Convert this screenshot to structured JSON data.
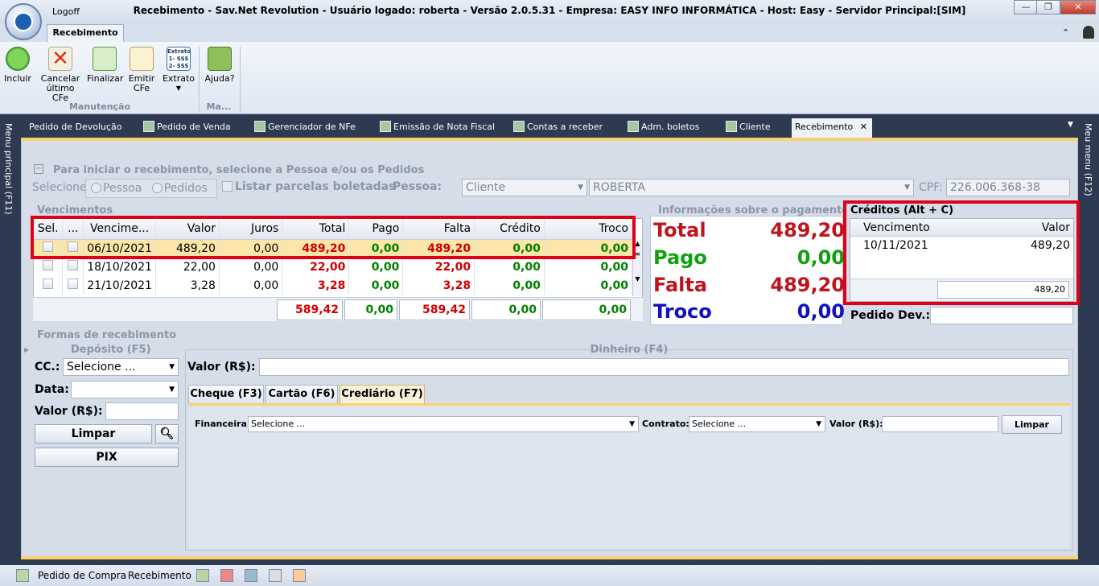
{
  "window": {
    "title": "Recebimento - Sav.Net Revolution - Usuário logado: roberta - Versão 2.0.5.31 - Empresa: EASY INFO INFORMÁTICA - Host: Easy - Servidor Principal:[SIM]",
    "logoff": "Logoff",
    "minimize": "—",
    "restore": "❐",
    "close": "✕"
  },
  "ribbon": {
    "tab": "Recebimento",
    "buttons": [
      {
        "label": "Incluir"
      },
      {
        "label": "Cancelar último CFe"
      },
      {
        "label": "Finalizar"
      },
      {
        "label": "Emitir CFe"
      },
      {
        "label": "Extrato",
        "icon_text": "Extrato 1- $$$ 2- $$$"
      },
      {
        "label": "Ajuda?"
      }
    ],
    "groups": [
      "Manutenção",
      "Ma..."
    ]
  },
  "doc_tabs": [
    "Pedido de Devolução",
    "Pedido de Venda",
    "Gerenciador de NFe",
    "Emissão de Nota Fiscal",
    "Contas a receber",
    "Adm. boletos",
    "Cliente",
    "Recebimento"
  ],
  "sidebars": {
    "left": "Menu principal (F11)",
    "right": "Meu menu (F12)"
  },
  "start": {
    "legend": "Para iniciar o recebimento, selecione a Pessoa e/ou os Pedidos",
    "selecione_label": "Selecione:",
    "opt_pessoa": "Pessoa",
    "opt_pedidos": "Pedidos",
    "listar": "Listar parcelas boletadas",
    "pessoa_label": "Pessoa:",
    "pessoa_type": "Cliente",
    "pessoa_name": "ROBERTA",
    "cpf_label": "CPF:",
    "cpf_value": "226.006.368-38"
  },
  "vencimentos": {
    "legend": "Vencimentos",
    "headers": [
      "Sel.",
      "...",
      "Vencime...",
      "Valor",
      "Juros",
      "Total",
      "Pago",
      "Falta",
      "Crédito",
      "Troco"
    ],
    "rows": [
      {
        "date": "06/10/2021",
        "valor": "489,20",
        "juros": "0,00",
        "total": "489,20",
        "pago": "0,00",
        "falta": "489,20",
        "credito": "0,00",
        "troco": "0,00"
      },
      {
        "date": "18/10/2021",
        "valor": "22,00",
        "juros": "0,00",
        "total": "22,00",
        "pago": "0,00",
        "falta": "22,00",
        "credito": "0,00",
        "troco": "0,00"
      },
      {
        "date": "21/10/2021",
        "valor": "3,28",
        "juros": "0,00",
        "total": "3,28",
        "pago": "0,00",
        "falta": "3,28",
        "credito": "0,00",
        "troco": "0,00"
      }
    ],
    "totals": {
      "total": "589,42",
      "pago": "0,00",
      "falta": "589,42",
      "credito": "0,00",
      "troco": "0,00"
    }
  },
  "info": {
    "legend": "Informações sobre o pagamento",
    "total_label": "Total",
    "total_value": "489,20",
    "pago_label": "Pago",
    "pago_value": "0,00",
    "falta_label": "Falta",
    "falta_value": "489,20",
    "troco_label": "Troco",
    "troco_value": "0,00"
  },
  "creditos": {
    "legend": "Créditos (Alt + C)",
    "headers": [
      "Vencimento",
      "Valor"
    ],
    "rows": [
      {
        "date": "10/11/2021",
        "valor": "489,20"
      }
    ],
    "total": "489,20"
  },
  "pedido_dev": {
    "label": "Pedido Dev.:",
    "value": ""
  },
  "formas": {
    "legend": "Formas de recebimento",
    "deposito": {
      "legend": "Depósito (F5)",
      "cc_label": "CC.:",
      "cc_value": "Selecione ...",
      "data_label": "Data:",
      "data_value": "",
      "valor_label": "Valor (R$):",
      "valor_value": "",
      "limpar": "Limpar",
      "pix": "PIX"
    },
    "dinheiro": {
      "legend": "Dinheiro (F4)",
      "valor_label": "Valor (R$):",
      "valor_value": ""
    },
    "tabs": [
      "Cheque (F3)",
      "Cartão (F6)",
      "Crediário (F7)"
    ],
    "crediario": {
      "financeira_label": "Financeira:",
      "financeira_value": "Selecione ...",
      "contrato_label": "Contrato:",
      "contrato_value": "Selecione ...",
      "valor_label": "Valor (R$):",
      "valor_value": "",
      "limpar": "Limpar"
    }
  },
  "statusbar": {
    "items": [
      "Pedido de Compra",
      "Recebimento"
    ]
  },
  "colors": {
    "accent_red": "#e00018",
    "total_red": "#c0141c",
    "pago_green": "#10a010",
    "troco_blue": "#1010c0",
    "tab_yellow": "#f7d36a"
  }
}
